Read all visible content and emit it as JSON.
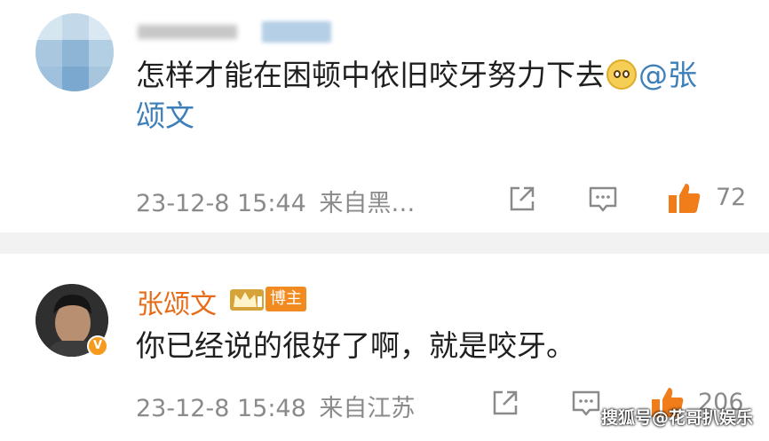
{
  "comments": [
    {
      "text_line1_prefix": "怎样才能在困顿中依旧咬牙努力下去",
      "emoji": "pleading-face-icon",
      "mention_line1": "@张",
      "mention_line2": "颂文",
      "timestamp": "23-12-8 15:44",
      "source": "来自黑…",
      "likes": "72"
    },
    {
      "username": "张颂文",
      "badge_label": "博主",
      "text": "你已经说的很好了啊，就是咬牙。",
      "timestamp": "23-12-8 15:48",
      "source": "来自江苏",
      "likes": "206"
    }
  ],
  "watermark": "搜狐号@花哥扒娱乐",
  "colors": {
    "like_orange": "#f07c1a",
    "mention_blue": "#3d7fb8",
    "username_orange": "#e86c18",
    "meta_gray": "#8a8a8a"
  }
}
